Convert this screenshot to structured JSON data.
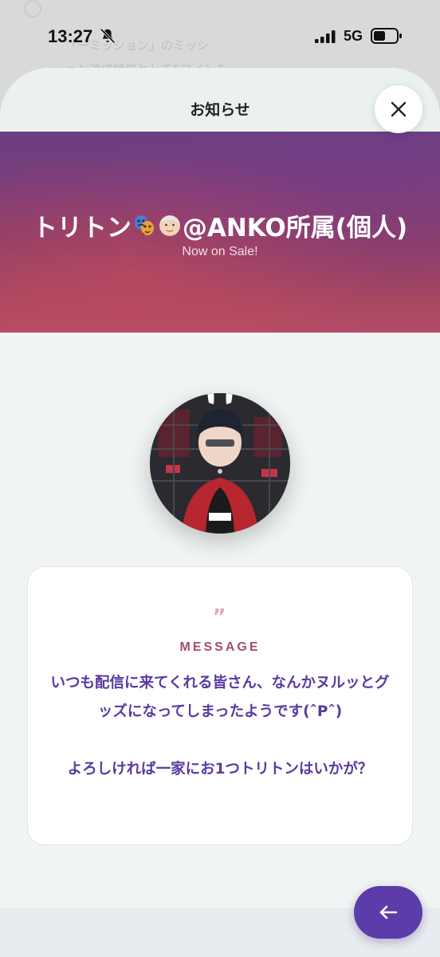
{
  "status_bar": {
    "time": "13:27",
    "network": "5G",
    "icons": [
      "bell-slash-icon",
      "signal-icon",
      "battery-icon"
    ]
  },
  "background_page": {
    "lines": [
      "「ーミッション」のミッシ",
      "ョン達成特典として5コインを"
    ]
  },
  "sheet": {
    "title": "お知らせ",
    "close_icon": "close-icon"
  },
  "hero": {
    "title_prefix": "トリトン",
    "title_emojis": [
      "performing-arts-emoji",
      "old-man-emoji"
    ],
    "title_suffix": "@ANKO所属(個人)",
    "subtitle": "Now on Sale!"
  },
  "avatar": {
    "description_icon": "avatar-image"
  },
  "message": {
    "quote_mark": "”",
    "label": "MESSAGE",
    "paragraphs": [
      "いつも配信に来てくれる皆さん、なんかヌルッとグッズになってしまったようです(ˆPˆ)",
      "よろしければ一家にお1つトリトンはいかが？"
    ]
  },
  "back_button": {
    "icon": "arrow-left-icon"
  },
  "colors": {
    "accent": "#5b3ca8",
    "message_text": "#5a3aa0",
    "label": "#a24e70",
    "hero_top": "#6a3f82",
    "hero_bottom": "#b24c68"
  }
}
